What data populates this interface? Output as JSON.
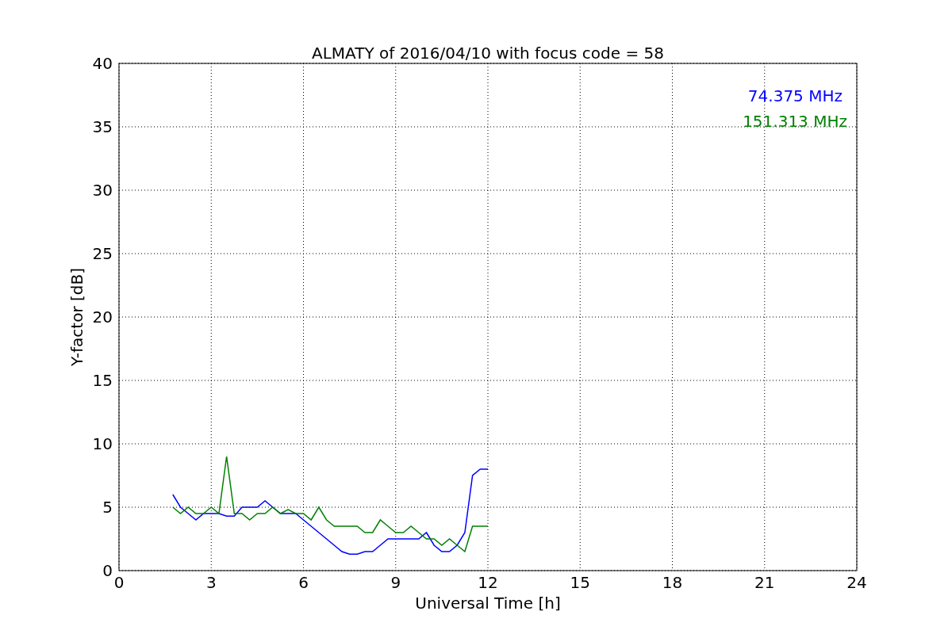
{
  "chart_data": {
    "type": "line",
    "title": "ALMATY of 2016/04/10 with focus code = 58",
    "xlabel": "Universal Time [h]",
    "ylabel": "Y-factor [dB]",
    "x": [
      1.75,
      2,
      2.25,
      2.5,
      2.75,
      3,
      3.25,
      3.5,
      3.75,
      4,
      4.25,
      4.5,
      4.75,
      5,
      5.25,
      5.5,
      5.75,
      6,
      6.25,
      6.5,
      6.75,
      7,
      7.25,
      7.5,
      7.75,
      8,
      8.25,
      8.5,
      8.75,
      9,
      9.25,
      9.5,
      9.75,
      10,
      10.25,
      10.5,
      10.75,
      11,
      11.25,
      11.5,
      11.75,
      12
    ],
    "series": [
      {
        "name": "74.375 MHz",
        "color": "#0000ff",
        "values": [
          6,
          5,
          4.5,
          4,
          4.5,
          4.5,
          4.5,
          4.3,
          4.3,
          5,
          5,
          5,
          5.5,
          5,
          4.5,
          4.5,
          4.5,
          4,
          3.5,
          3,
          2.5,
          2,
          1.5,
          1.3,
          1.3,
          1.5,
          1.5,
          2,
          2.5,
          2.5,
          2.5,
          2.5,
          2.5,
          3,
          2,
          1.5,
          1.5,
          2,
          3,
          7.5,
          8,
          8
        ]
      },
      {
        "name": "151.313 MHz",
        "color": "#008000",
        "values": [
          5,
          4.5,
          5,
          4.5,
          4.5,
          5,
          4.5,
          9,
          4.5,
          4.5,
          4,
          4.5,
          4.5,
          5,
          4.5,
          4.8,
          4.5,
          4.5,
          4,
          5,
          4,
          3.5,
          3.5,
          3.5,
          3.5,
          3,
          3,
          4,
          3.5,
          3,
          3,
          3.5,
          3,
          2.5,
          2.5,
          2,
          2.5,
          2,
          1.5,
          3.5,
          3.5,
          3.5
        ]
      }
    ],
    "grid": true,
    "xlim": [
      0,
      24
    ],
    "ylim": [
      0,
      40
    ],
    "xticks": [
      0,
      3,
      6,
      9,
      12,
      15,
      18,
      21,
      24
    ],
    "yticks": [
      0,
      5,
      10,
      15,
      20,
      25,
      30,
      35,
      40
    ]
  }
}
